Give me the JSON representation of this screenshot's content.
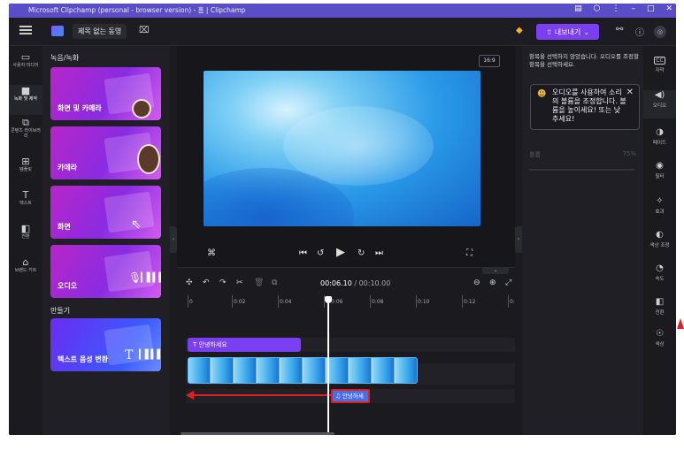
{
  "window": {
    "title": "Microsoft Clipchamp (personal - browser version) - 홈 | Clipchamp"
  },
  "header": {
    "project_title": "제목 없는 동영",
    "export_label": "내보내기"
  },
  "left_nav": [
    {
      "label": "사용자 미디어",
      "icon": "folder-icon"
    },
    {
      "label": "녹화 및 제작",
      "icon": "record-icon"
    },
    {
      "label": "콘텐츠 라이브러리",
      "icon": "library-icon"
    },
    {
      "label": "템플릿",
      "icon": "templates-icon"
    },
    {
      "label": "텍스트",
      "icon": "text-icon"
    },
    {
      "label": "전환",
      "icon": "transition-icon"
    },
    {
      "label": "브랜드 키트",
      "icon": "brand-kit-icon"
    }
  ],
  "panel": {
    "section_record": "녹음/녹화",
    "cards": [
      {
        "label": "화면 및 카메라"
      },
      {
        "label": "카메라"
      },
      {
        "label": "화면"
      },
      {
        "label": "오디오"
      }
    ],
    "section_create": "만들기",
    "tts_label": "텍스트 음성 변환"
  },
  "preview": {
    "aspect_ratio": "16:9"
  },
  "timeline": {
    "current_time": "00:06.10",
    "total_time": "/ 00:10.00",
    "ticks": [
      "0",
      "0:02",
      "0:04",
      "0:06",
      "0:08",
      "0:10",
      "0:12",
      "0:14"
    ],
    "text_clip": "안녕하세요",
    "audio_clip": "안녕하세"
  },
  "properties": {
    "info": "항목을 선택하지 않았습니다. 오디오를 조정할 항목을 선택하세요.",
    "tooltip": "오디오를 사용하여 소리의 볼륨을 조정합니다. 볼륨을 높이세요! 또는 낮추세요!",
    "volume_label": "볼륨",
    "volume_value": "75%"
  },
  "right_nav": [
    {
      "label": "자막",
      "icon": "captions-icon"
    },
    {
      "label": "오디오",
      "icon": "audio-icon"
    },
    {
      "label": "페이드",
      "icon": "fade-icon"
    },
    {
      "label": "필터",
      "icon": "filter-icon"
    },
    {
      "label": "효과",
      "icon": "effects-icon"
    },
    {
      "label": "색상 조정",
      "icon": "color-adjust-icon"
    },
    {
      "label": "속도",
      "icon": "speed-icon"
    },
    {
      "label": "전환",
      "icon": "transition-icon"
    },
    {
      "label": "색상",
      "icon": "color-icon"
    }
  ],
  "colors": {
    "accent": "#7b3ff2",
    "titlebar": "#5b4cc7",
    "annotation": "#e02020"
  }
}
